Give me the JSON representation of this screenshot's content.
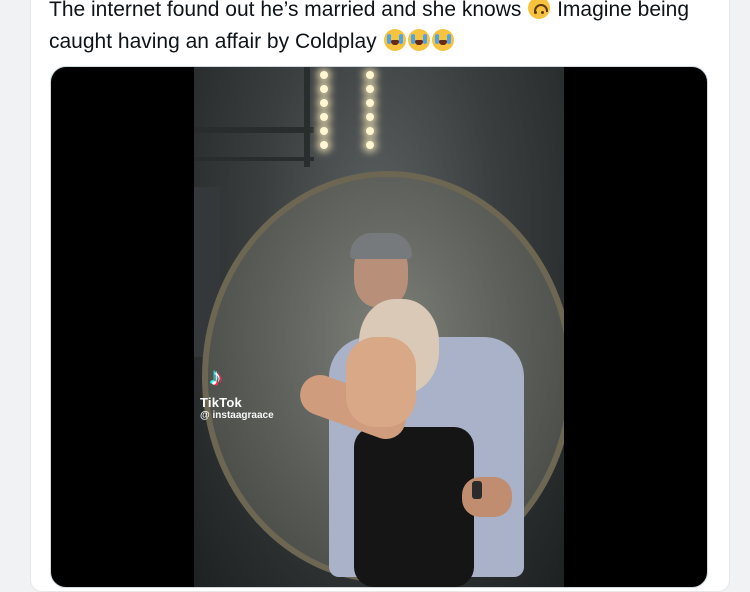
{
  "tweet": {
    "text_part1": "The internet found out he’s married and she knows",
    "text_part2": "Imagine being caught having an affair by Coldplay",
    "emoji_1": "upside-down-face",
    "emoji_2": "loudly-crying-face",
    "emoji_3": "loudly-crying-face",
    "emoji_4": "loudly-crying-face"
  },
  "video": {
    "watermark_brand": "TikTok",
    "watermark_handle": "@ instaagraace",
    "logo_glyph": "♪"
  },
  "colors": {
    "text": "#0f1419",
    "media_bg": "#000000",
    "card_border": "#cfd9de"
  }
}
